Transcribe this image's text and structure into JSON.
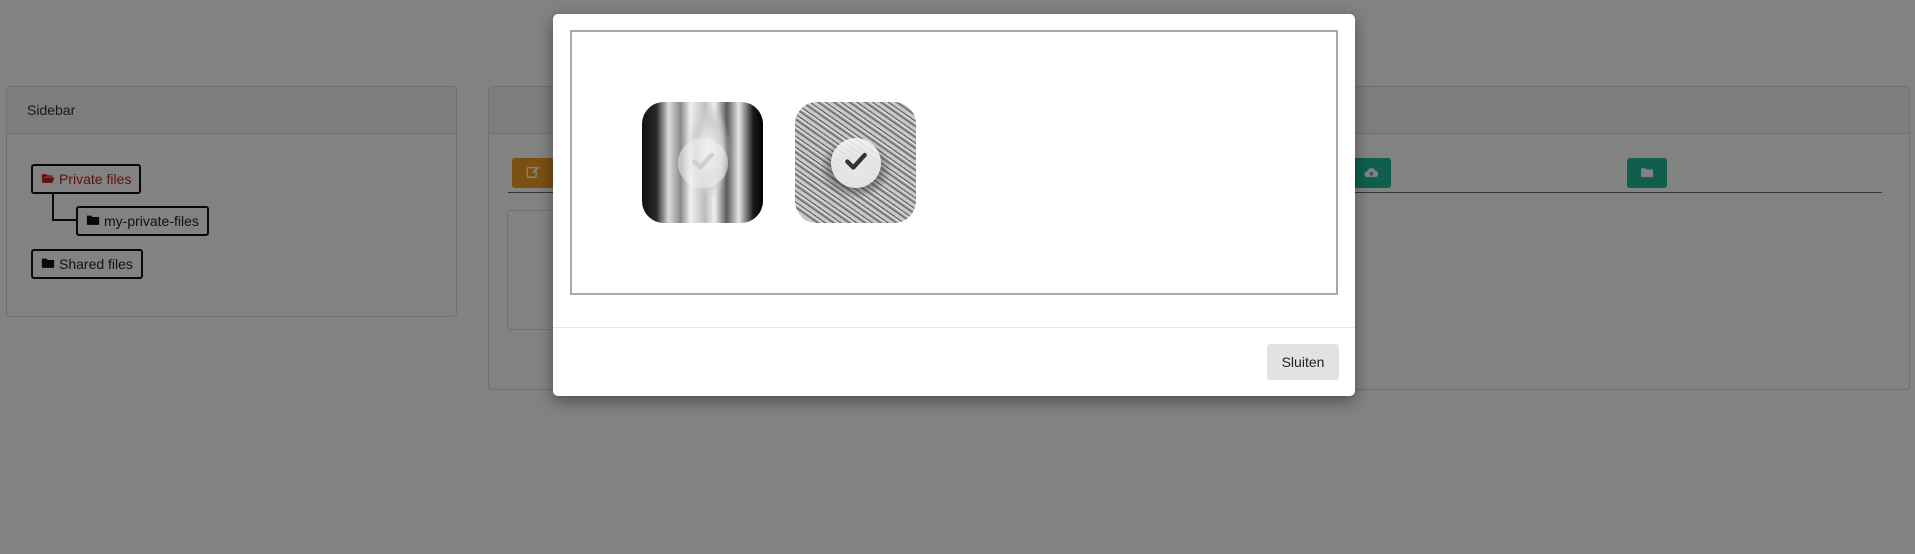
{
  "sidebar": {
    "title": "Sidebar",
    "tree": [
      {
        "label": "Private files",
        "icon": "folder-open-icon",
        "active": true
      },
      {
        "label": "my-private-files",
        "icon": "folder-icon",
        "active": false
      },
      {
        "label": "Shared files",
        "icon": "folder-icon",
        "active": false
      }
    ]
  },
  "toolbar": {
    "buttons": [
      {
        "icon": "edit-icon",
        "color": "#f0a020"
      },
      {
        "icon": "cloud-upload-icon",
        "color": "#1fb89a"
      },
      {
        "icon": "folder-icon",
        "color": "#1fb89a"
      }
    ]
  },
  "modal": {
    "images": [
      {
        "icon": "check-icon",
        "description": "portrait-photo"
      },
      {
        "icon": "check-icon",
        "description": "hair-photo"
      }
    ],
    "close_label": "Sluiten"
  },
  "colors": {
    "active_tree": "#c0201a",
    "overlay": "rgba(0,0,0,0.49)",
    "folder_icon": "#111111"
  }
}
